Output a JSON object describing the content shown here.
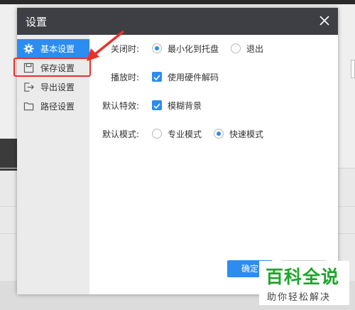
{
  "dialog": {
    "title": "设置"
  },
  "sidebar": {
    "items": [
      {
        "label": "基本设置",
        "icon": "gear-icon",
        "active": true
      },
      {
        "label": "保存设置",
        "icon": "save-icon",
        "active": false
      },
      {
        "label": "导出设置",
        "icon": "export-icon",
        "active": false
      },
      {
        "label": "路径设置",
        "icon": "folder-icon",
        "active": false
      }
    ]
  },
  "settings": {
    "close_behavior": {
      "label": "关闭时:",
      "options": [
        {
          "label": "最小化到托盘",
          "selected": true
        },
        {
          "label": "退出",
          "selected": false
        }
      ]
    },
    "playback": {
      "label": "播放时:",
      "option": {
        "label": "使用硬件解码",
        "checked": true
      }
    },
    "default_effect": {
      "label": "默认特效:",
      "option": {
        "label": "模糊背景",
        "checked": true
      }
    },
    "default_mode": {
      "label": "默认模式:",
      "options": [
        {
          "label": "专业模式",
          "selected": false
        },
        {
          "label": "快速模式",
          "selected": true
        }
      ]
    }
  },
  "footer": {
    "ok_label": "确定"
  },
  "watermark": {
    "main": "百科全说",
    "sub": "助你轻松解决"
  },
  "colors": {
    "accent": "#2d8cf0",
    "titlebar": "#3d3f44",
    "highlight": "#e8312c",
    "watermark_green": "#1ea52a"
  }
}
